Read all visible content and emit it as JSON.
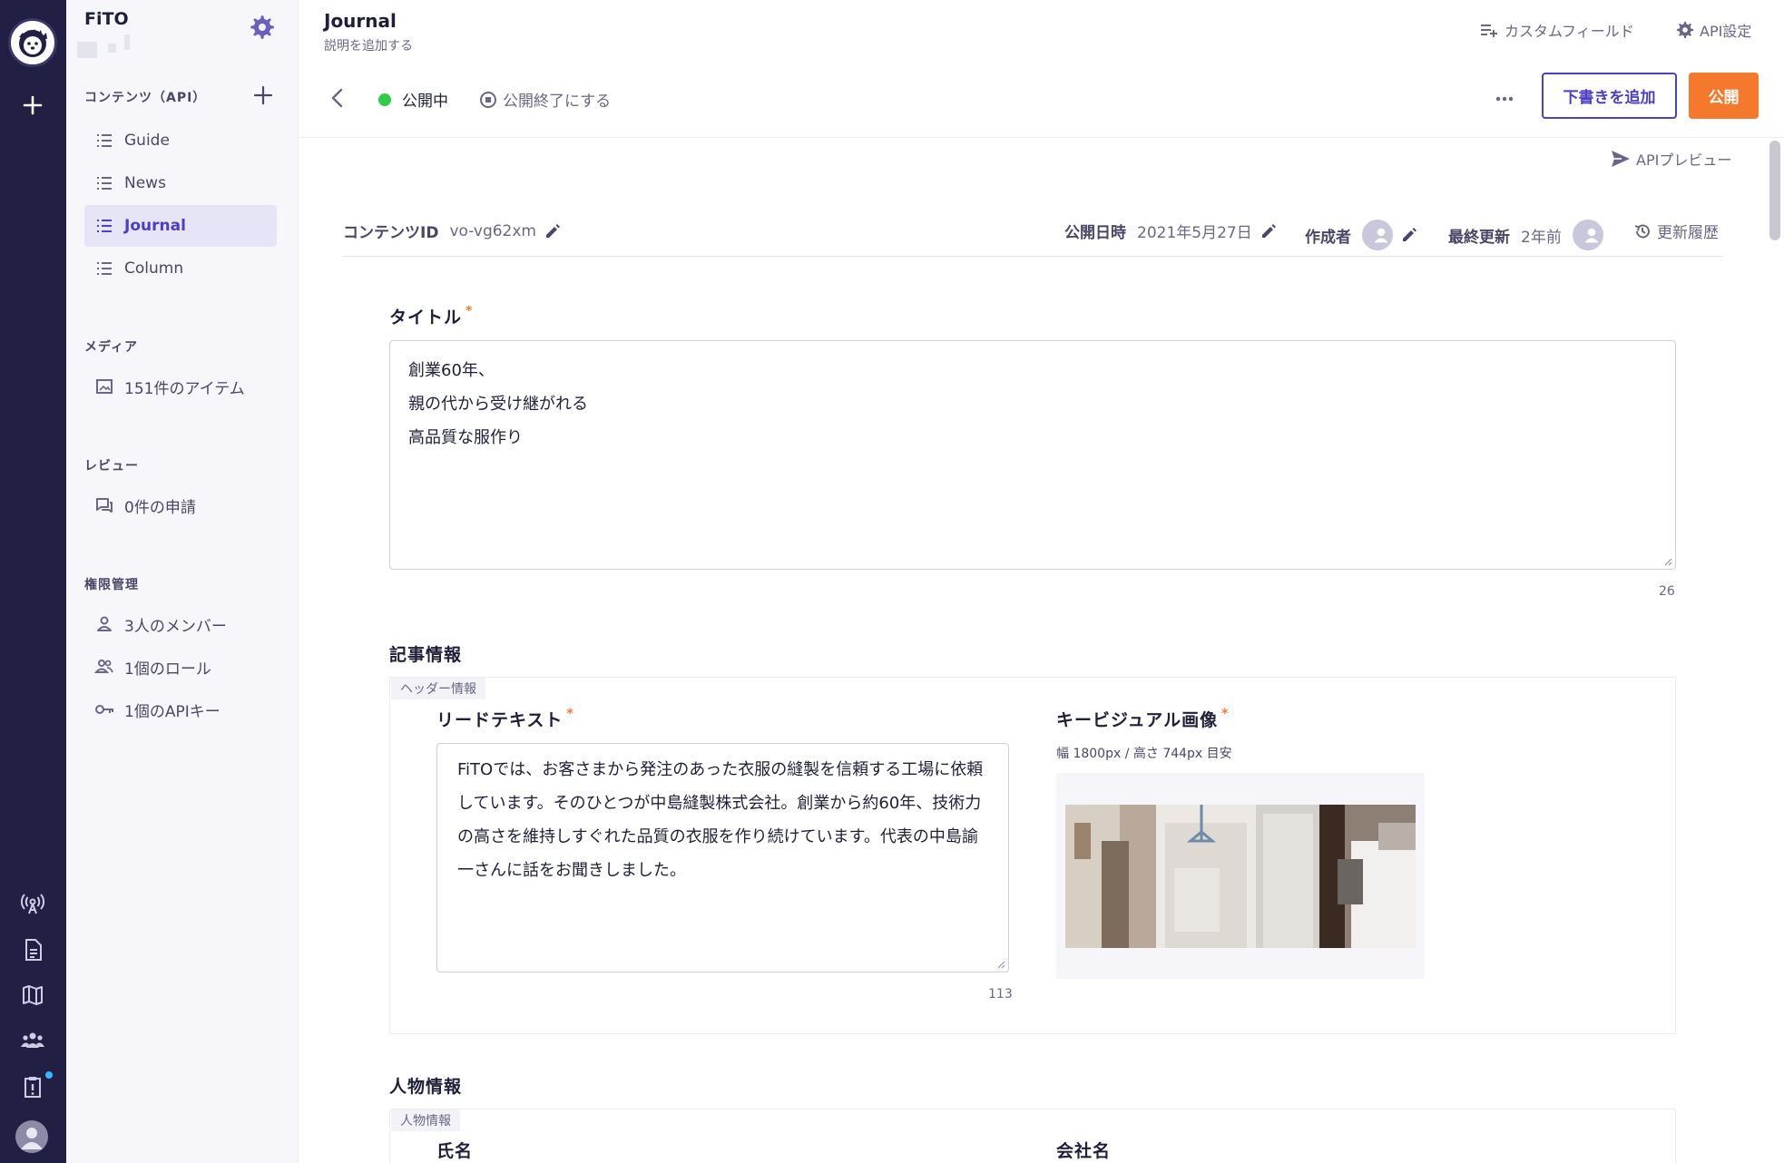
{
  "sidebar": {
    "title": "FiTO",
    "sections": {
      "contents": "コンテンツ（API）",
      "media": "メディア",
      "review": "レビュー",
      "permissions": "権限管理"
    },
    "api_items": [
      {
        "label": "Guide",
        "icon": "list-icon"
      },
      {
        "label": "News",
        "icon": "list-icon"
      },
      {
        "label": "Journal",
        "icon": "list-icon",
        "active": true
      },
      {
        "label": "Column",
        "icon": "list-icon"
      }
    ],
    "media_item": "151件のアイテム",
    "review_item": "0件の申請",
    "perm_items": [
      "3人のメンバー",
      "1個のロール",
      "1個のAPIキー"
    ]
  },
  "header": {
    "title": "Journal",
    "description": "説明を追加する",
    "custom_fields": "カスタムフィールド",
    "api_settings": "API設定"
  },
  "toolbar": {
    "status": "公開中",
    "unpublish": "公開終了にする",
    "add_draft": "下書きを追加",
    "publish": "公開"
  },
  "api_preview": "APIプレビュー",
  "meta": {
    "content_id_label": "コンテンツID",
    "content_id": "vo-vg62xm",
    "published_label": "公開日時",
    "published": "2021年5月27日",
    "author_label": "作成者",
    "updated_label": "最終更新",
    "updated": "2年前",
    "history": "更新履歴"
  },
  "form": {
    "title_label": "タイトル",
    "title_required": "*",
    "title_lines": [
      "創業60年、",
      "親の代から受け継がれる",
      "高品質な服作り"
    ],
    "title_count": "26",
    "article_section": "記事情報",
    "header_group_tag": "ヘッダー情報",
    "lead_label": "リードテキスト",
    "lead_text": "FiTOでは、お客さまから発注のあった衣服の縫製を信頼する工場に依頼しています。そのひとつが中島縫製株式会社。創業から約60年、技術力の高さを維持しすぐれた品質の衣服を作り続けています。代表の中島諭一さんに話をお聞きしました。",
    "lead_count": "113",
    "kv_label": "キービジュアル画像",
    "kv_hint": "幅 1800px / 高さ 744px 目安",
    "person_section": "人物情報",
    "person_group_tag": "人物情報",
    "name_label": "氏名",
    "company_label": "会社名"
  },
  "colors": {
    "rail": "#211f44",
    "accent": "#4b3fc4",
    "publish": "#f4792c",
    "status_green": "#2ecc47"
  }
}
